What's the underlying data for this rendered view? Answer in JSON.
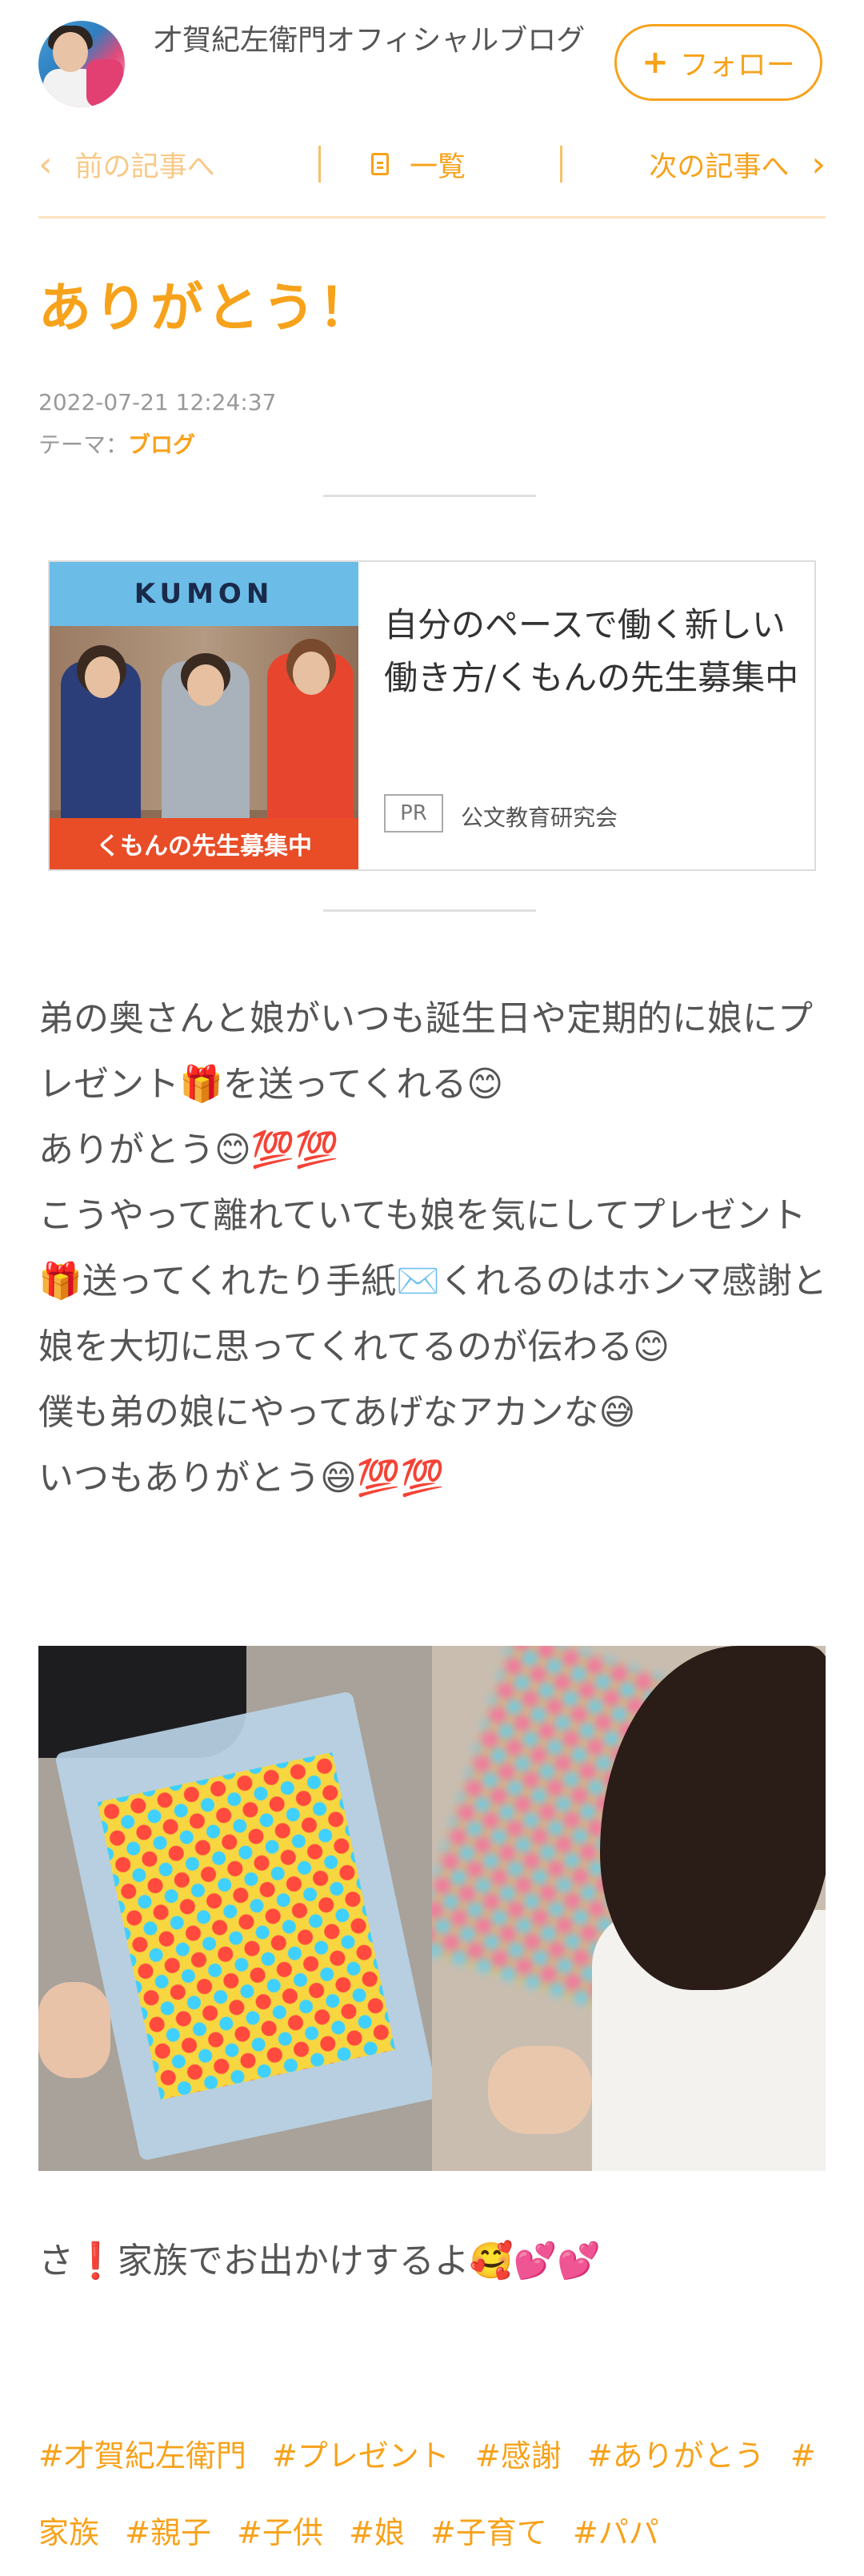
{
  "header": {
    "blog_title": "才賀紀左衛門オフィシャルブログ",
    "follow_label": "フォロー",
    "follow_icon": "plus-icon"
  },
  "nav": {
    "prev_label": "前の記事へ",
    "list_label": "一覧",
    "next_label": "次の記事へ"
  },
  "article": {
    "title": "ありがとう！",
    "date": "2022-07-21 12:24:37",
    "theme_prefix": "テーマ：",
    "theme": "ブログ"
  },
  "ad": {
    "brand": "KUMON",
    "banner": "くもんの先生募集中",
    "headline": "自分のペースで働く新しい働き方/くもんの先生募集中",
    "pr_label": "PR",
    "sponsor": "公文教育研究会"
  },
  "body": {
    "lines": [
      "弟の奥さんと娘がいつも誕生日や定期的に娘にプレゼント🎁を送ってくれる😊",
      "ありがとう😊💯💯",
      "こうやって離れていても娘を気にしてプレゼント🎁送ってくれたり手紙✉️くれるのはホンマ感謝と娘を大切に思ってくれてるのが伝わる😊",
      "僕も弟の娘にやってあげなアカンな😅",
      "いつもありがとう😄💯💯"
    ],
    "closing": "さ❗️家族でお出かけするよ🥰💕💕"
  },
  "tags": [
    "#才賀紀左衛門",
    "#プレゼント",
    "#感謝",
    "#ありがとう",
    "#家族",
    "#親子",
    "#子供",
    "#娘",
    "#子育て",
    "#パパ"
  ],
  "colors": {
    "accent": "#f7a21b",
    "text": "#555555"
  }
}
